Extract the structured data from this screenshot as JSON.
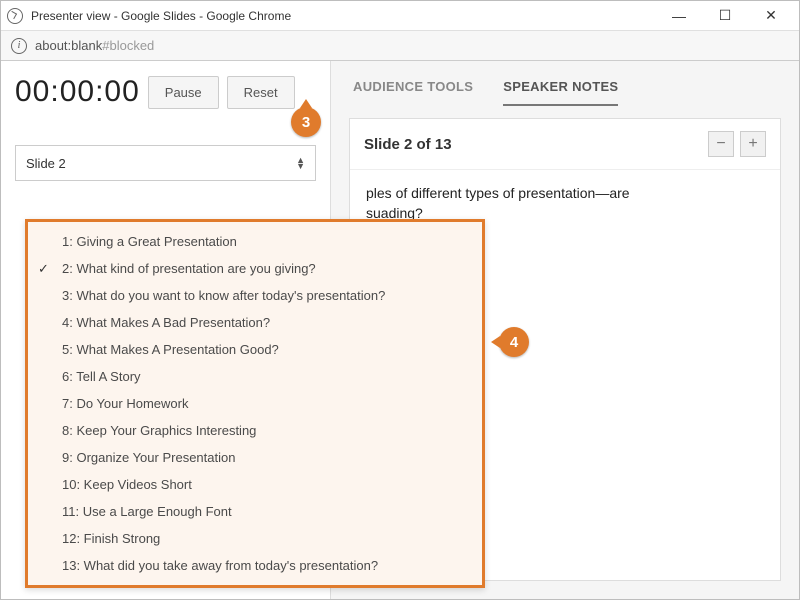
{
  "window": {
    "title": "Presenter view - Google Slides - Google Chrome"
  },
  "address": {
    "full": "about:blank#blocked",
    "main": "about:blank",
    "dim": "#blocked"
  },
  "win_controls": {
    "min": "—",
    "max": "☐",
    "close": "✕"
  },
  "left": {
    "timer": "00:00:00",
    "pause": "Pause",
    "reset": "Reset",
    "slide_selector": "Slide 2"
  },
  "tabs": {
    "audience": "AUDIENCE TOOLS",
    "speaker": "SPEAKER NOTES",
    "active": "speaker"
  },
  "notes": {
    "header": "Slide 2 of 13",
    "body_visible": "ples of different types of presentation—are\nsuading?"
  },
  "dropdown": {
    "selected_index": 1,
    "items": [
      "1: Giving a Great Presentation",
      "2: What kind of presentation are you giving?",
      "3: What do you want to know after today's presentation?",
      "4: What Makes A Bad Presentation?",
      "5: What Makes A Presentation Good?",
      "6: Tell A Story",
      "7: Do Your Homework",
      "8: Keep Your Graphics Interesting",
      "9: Organize Your Presentation",
      "10: Keep Videos Short",
      "11: Use a Large Enough Font",
      "12: Finish Strong",
      "13: What did you take away from today's presentation?"
    ]
  },
  "callouts": {
    "c3": "3",
    "c4": "4"
  }
}
